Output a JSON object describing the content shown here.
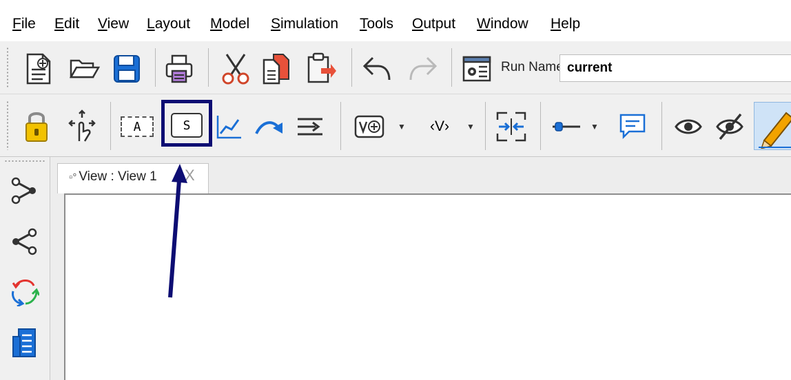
{
  "menu": {
    "items": [
      {
        "mnemonic": "F",
        "rest": "ile"
      },
      {
        "mnemonic": "E",
        "rest": "dit"
      },
      {
        "mnemonic": "V",
        "rest": "iew"
      },
      {
        "mnemonic": "L",
        "rest": "ayout"
      },
      {
        "mnemonic": "M",
        "rest": "odel"
      },
      {
        "mnemonic": "S",
        "rest": "imulation"
      },
      {
        "mnemonic": "T",
        "rest": "ools"
      },
      {
        "mnemonic": "O",
        "rest": "utput"
      },
      {
        "mnemonic": "W",
        "rest": "indow"
      },
      {
        "mnemonic": "H",
        "rest": "elp"
      }
    ]
  },
  "toolbar1": {
    "run_name_label": "Run Name:",
    "run_name_value": "current",
    "icons": [
      "new-model-icon",
      "open-folder-icon",
      "save-icon",
      "print-icon",
      "cut-icon",
      "copy-icon",
      "paste-icon",
      "undo-icon",
      "redo-icon",
      "simulation-settings-icon"
    ]
  },
  "toolbar2": {
    "text_tool_label": "A",
    "shadow_variable_label": "S",
    "variable_dropdown_label": "‹V›",
    "icons": [
      "lock-icon",
      "move-icon",
      "text-tool-icon",
      "shadow-variable-icon",
      "line-chart-icon",
      "arrow-icon",
      "equation-icon",
      "variable-add-icon",
      "variable-dropdown-icon",
      "merge-icon",
      "slider-icon",
      "comment-icon",
      "eye-icon",
      "hide-icon",
      "pencil-icon"
    ]
  },
  "palette": {
    "icons": [
      "causes-tree-icon",
      "uses-tree-icon",
      "loops-icon",
      "document-icon"
    ]
  },
  "tab": {
    "label": "View : View 1",
    "close_label": "X"
  },
  "colors": {
    "annotation": "#0d0d73",
    "toolbar_bg": "#f0f0f0",
    "icon_blue": "#1a6fd6",
    "icon_yellow": "#f2c200"
  }
}
